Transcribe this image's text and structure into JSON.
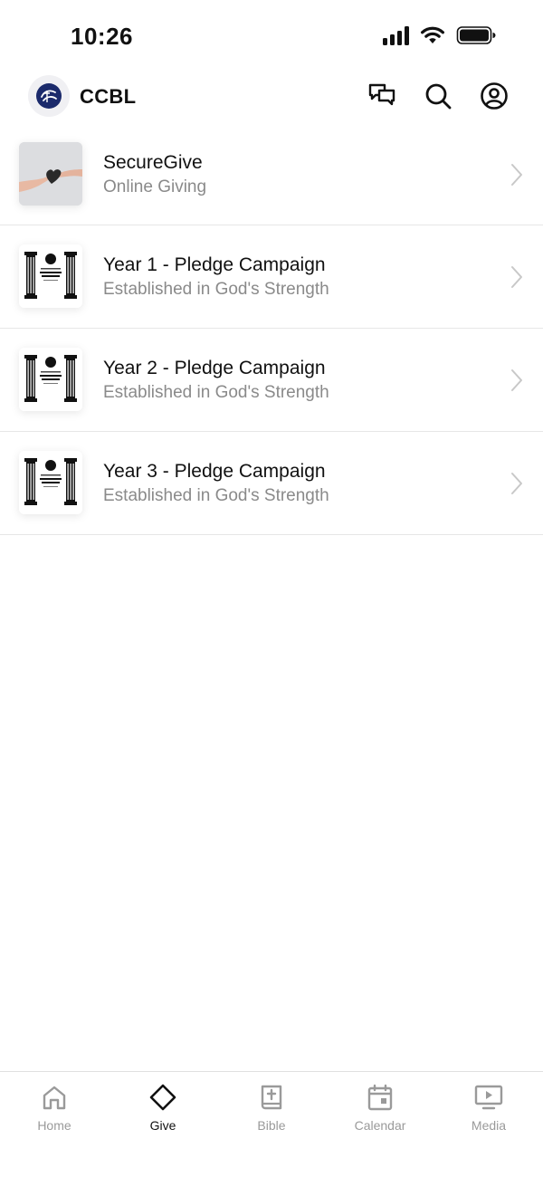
{
  "status_bar": {
    "time": "10:26"
  },
  "header": {
    "title": "CCBL",
    "icons": [
      "chat-bubbles-icon",
      "search-icon",
      "account-icon"
    ]
  },
  "list": {
    "items": [
      {
        "title": "SecureGive",
        "subtitle": "Online Giving",
        "thumb": "hands-heart-photo"
      },
      {
        "title": "Year 1 - Pledge Campaign",
        "subtitle": "Established in God's Strength",
        "thumb": "pillars-logo"
      },
      {
        "title": "Year 2 - Pledge Campaign",
        "subtitle": "Established in God's Strength",
        "thumb": "pillars-logo"
      },
      {
        "title": "Year 3 - Pledge Campaign",
        "subtitle": "Established in God's Strength",
        "thumb": "pillars-logo"
      }
    ]
  },
  "tab_bar": {
    "active": "Give",
    "tabs": [
      {
        "label": "Home",
        "icon": "home-icon"
      },
      {
        "label": "Give",
        "icon": "diamond-icon"
      },
      {
        "label": "Bible",
        "icon": "bible-icon"
      },
      {
        "label": "Calendar",
        "icon": "calendar-icon"
      },
      {
        "label": "Media",
        "icon": "media-icon"
      }
    ]
  },
  "colors": {
    "text": "#111111",
    "subtext": "#8a8a8a",
    "inactive": "#9a9a9a",
    "divider": "#e6e6e6",
    "brand_navy": "#1b2a6b"
  }
}
